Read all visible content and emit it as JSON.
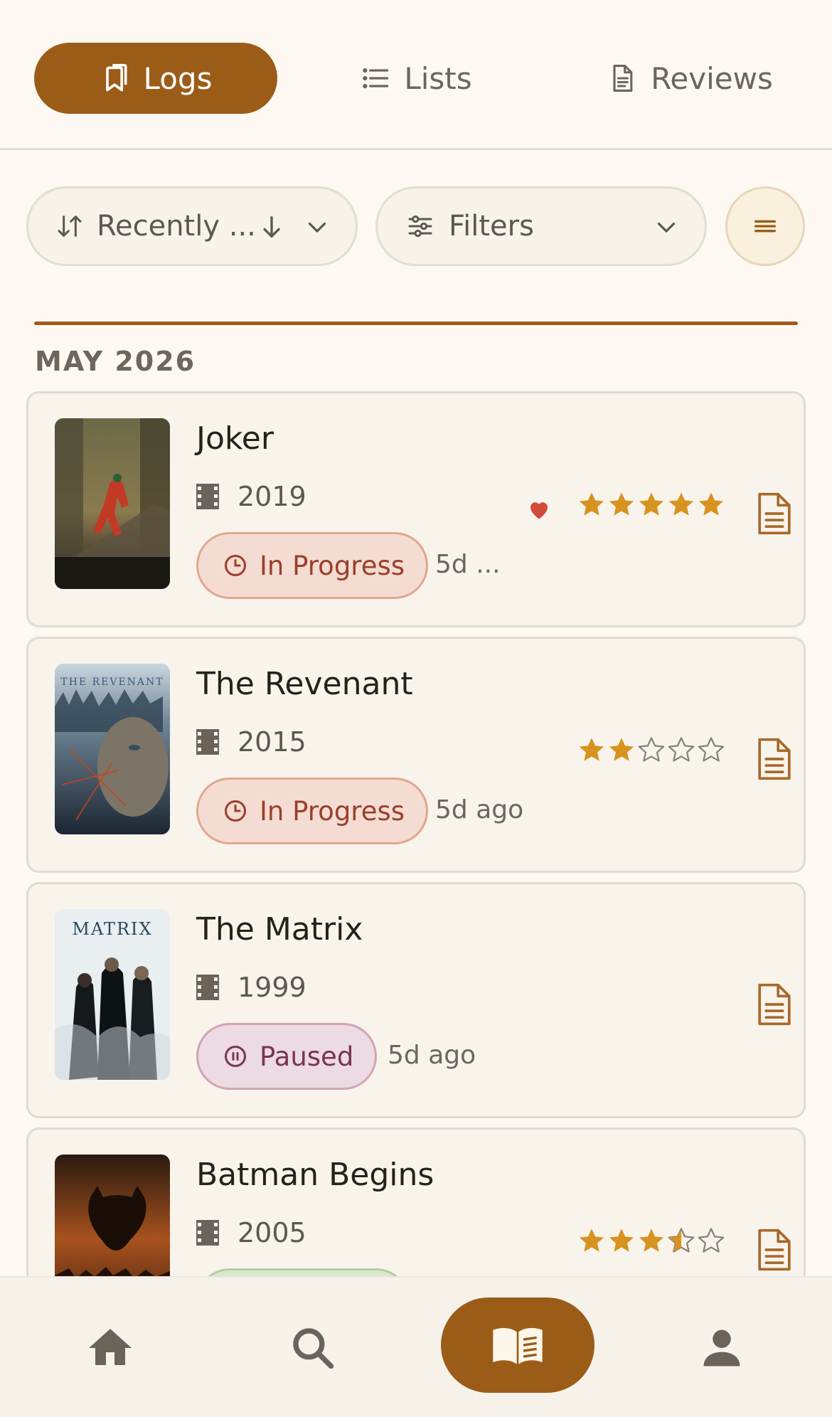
{
  "tabs": {
    "logs": {
      "label": "Logs",
      "icon": "bookmarks-icon"
    },
    "lists": {
      "label": "Lists",
      "icon": "list-icon"
    },
    "reviews": {
      "label": "Reviews",
      "icon": "document-icon"
    }
  },
  "controls": {
    "sort_label": "Recently ...",
    "filter_label": "Filters"
  },
  "section": {
    "header": "MAY 2026"
  },
  "logs": [
    {
      "title": "Joker",
      "year": "2019",
      "status": "In Progress",
      "ago": "5d ...",
      "favorite": true,
      "rating": 5
    },
    {
      "title": "The Revenant",
      "year": "2015",
      "status": "In Progress",
      "ago": "5d ago",
      "favorite": false,
      "rating": 2
    },
    {
      "title": "The Matrix",
      "year": "1999",
      "status": "Paused",
      "ago": "5d ago",
      "favorite": false,
      "rating": null
    },
    {
      "title": "Batman Begins",
      "year": "2005",
      "status": "",
      "ago": "",
      "favorite": false,
      "rating": 3.5
    }
  ],
  "colors": {
    "accent": "#9b5c18",
    "star": "#d8921f",
    "heart": "#d14a3a",
    "background": "#fdf9f2"
  },
  "bottom_nav": {
    "items": [
      "home-icon",
      "search-icon",
      "open-book-icon",
      "person-icon"
    ]
  }
}
